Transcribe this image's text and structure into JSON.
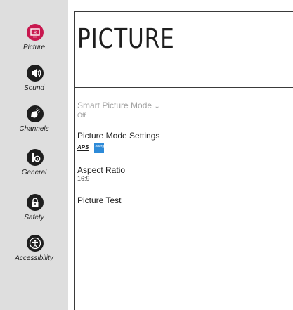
{
  "sidebar": {
    "items": [
      {
        "label": "Picture",
        "icon": "picture-icon",
        "active": true
      },
      {
        "label": "Sound",
        "icon": "sound-icon"
      },
      {
        "label": "Channels",
        "icon": "channels-icon"
      },
      {
        "label": "General",
        "icon": "general-icon"
      },
      {
        "label": "Safety",
        "icon": "lock-icon"
      },
      {
        "label": "Accessibility",
        "icon": "accessibility-icon"
      }
    ]
  },
  "main": {
    "title": "PICTURE",
    "items": [
      {
        "title": "Smart Picture Mode",
        "value": "Off",
        "chevron": "⌄",
        "disabled": true
      },
      {
        "title": "Picture Mode Settings",
        "badges": [
          "APS",
          "energy star"
        ]
      },
      {
        "title": "Aspect Ratio",
        "value": "16:9"
      },
      {
        "title": "Picture Test"
      }
    ],
    "badge_aps_text": "APS",
    "badge_energy_text": "energy"
  },
  "colors": {
    "accent": "#c8184f",
    "sidebar_bg": "#dedede",
    "icon_bg": "#1e1e1e",
    "disabled_text": "#a0a0a0"
  }
}
